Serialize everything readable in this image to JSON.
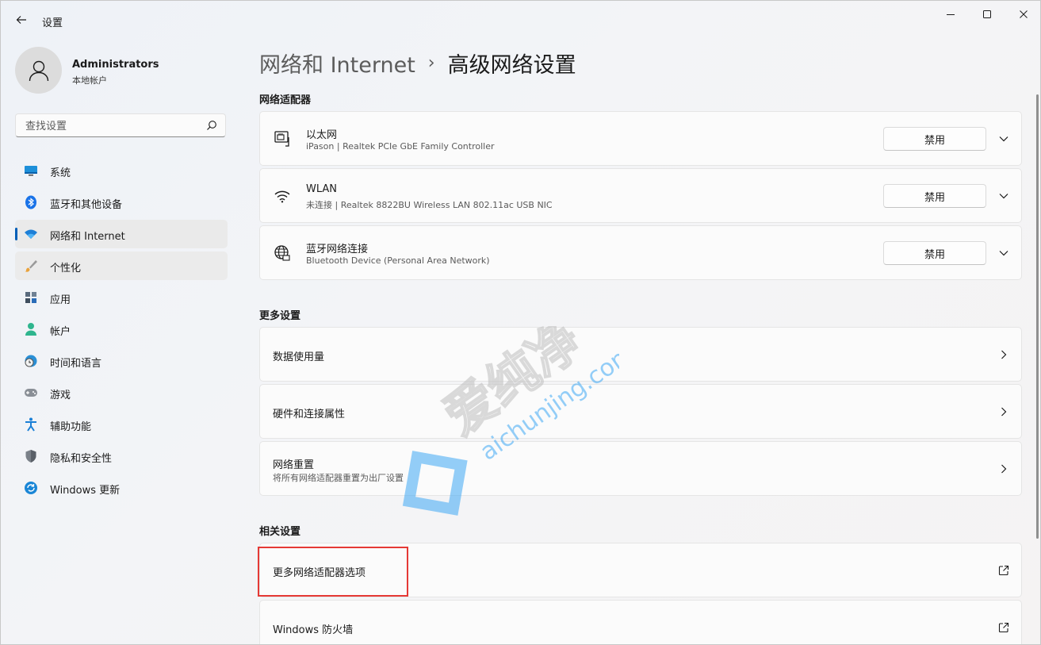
{
  "window": {
    "title": "设置",
    "controls": {
      "minimize": "minimize-icon",
      "maximize": "maximize-icon",
      "close": "close-icon"
    }
  },
  "profile": {
    "name": "Administrators",
    "account_type": "本地帐户"
  },
  "search": {
    "placeholder": "查找设置"
  },
  "sidebar": {
    "items": [
      {
        "label": "系统",
        "icon": "display-icon"
      },
      {
        "label": "蓝牙和其他设备",
        "icon": "bluetooth-icon"
      },
      {
        "label": "网络和 Internet",
        "icon": "wifi-icon",
        "selected": true
      },
      {
        "label": "个性化",
        "icon": "brush-icon"
      },
      {
        "label": "应用",
        "icon": "apps-icon"
      },
      {
        "label": "帐户",
        "icon": "person-icon"
      },
      {
        "label": "时间和语言",
        "icon": "globe-clock-icon"
      },
      {
        "label": "游戏",
        "icon": "gamepad-icon"
      },
      {
        "label": "辅助功能",
        "icon": "accessibility-icon"
      },
      {
        "label": "隐私和安全性",
        "icon": "shield-icon"
      },
      {
        "label": "Windows 更新",
        "icon": "update-icon"
      }
    ]
  },
  "breadcrumb": {
    "parent": "网络和 Internet",
    "separator": "›",
    "current": "高级网络设置"
  },
  "adapters": {
    "section_title": "网络适配器",
    "items": [
      {
        "title": "以太网",
        "subtitle": "iPason | Realtek PCIe GbE Family Controller",
        "button": "禁用",
        "icon": "ethernet-icon"
      },
      {
        "title": "WLAN",
        "subtitle": "未连接 | Realtek 8822BU Wireless LAN 802.11ac USB NIC",
        "button": "禁用",
        "icon": "wifi-icon"
      },
      {
        "title": "蓝牙网络连接",
        "subtitle": "Bluetooth Device (Personal Area Network)",
        "button": "禁用",
        "icon": "globe-network-icon"
      }
    ]
  },
  "more_settings": {
    "section_title": "更多设置",
    "items": [
      {
        "title": "数据使用量"
      },
      {
        "title": "硬件和连接属性"
      },
      {
        "title": "网络重置",
        "subtitle": "将所有网络适配器重置为出厂设置"
      }
    ]
  },
  "related_settings": {
    "section_title": "相关设置",
    "items": [
      {
        "title": "更多网络适配器选项",
        "icon": "external-link-icon"
      },
      {
        "title": "Windows 防火墙",
        "icon": "external-link-icon"
      }
    ]
  },
  "watermark": {
    "brand": "爱纯净",
    "url": "aichunjing.com"
  },
  "colors": {
    "accent": "#005fb8",
    "highlight": "#e53935",
    "watermark": "#3fa9f5"
  }
}
